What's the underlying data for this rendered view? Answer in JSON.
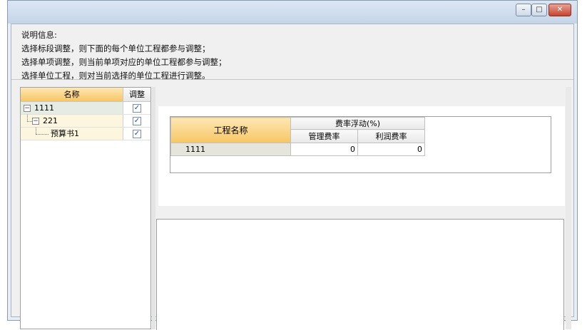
{
  "window": {
    "title": "",
    "buttons": {
      "minimize": "–",
      "maximize": "□",
      "close": "✕"
    }
  },
  "info": {
    "lines": [
      "说明信息:",
      "选择标段调整，则下面的每个单位工程都参与调整；",
      "选择单项调整，则当前单项对应的单位工程都参与调整；",
      "选择单位工程，则对当前选择的单位工程进行调整。"
    ]
  },
  "tree": {
    "headers": {
      "name": "名称",
      "adjust": "调整"
    },
    "rows": [
      {
        "label": "1111",
        "expander": "−",
        "checked": "✓"
      },
      {
        "label": "221",
        "expander": "−",
        "checked": "✓"
      },
      {
        "label": "预算书1",
        "checked": "✓"
      }
    ]
  },
  "fee_table": {
    "header_main": "工程名称",
    "header_group": "费率浮动(%)",
    "sub_headers": [
      "管理费率",
      "利润费率"
    ],
    "rows": [
      {
        "name": "1111",
        "mgmt": "0",
        "profit": "0"
      }
    ]
  }
}
